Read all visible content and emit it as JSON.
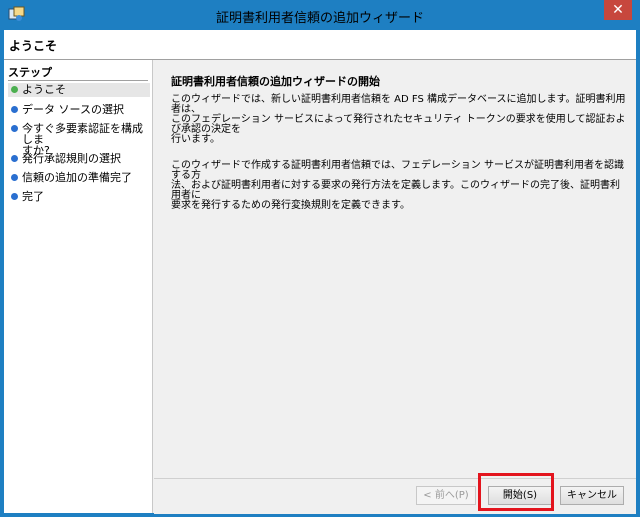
{
  "window": {
    "title": "証明書利用者信頼の追加ウィザード",
    "close_glyph": "✕"
  },
  "header": {
    "title": "ようこそ"
  },
  "sidebar": {
    "heading": "ステップ",
    "items": [
      {
        "label": "ようこそ",
        "bullet_color": "#4caf50"
      },
      {
        "label": "データ ソースの選択",
        "bullet_color": "#2a6fd0"
      },
      {
        "label": "今すぐ多要素認証を構成しま\nすか?",
        "bullet_color": "#2a6fd0"
      },
      {
        "label": "発行承認規則の選択",
        "bullet_color": "#2a6fd0"
      },
      {
        "label": "信頼の追加の準備完了",
        "bullet_color": "#2a6fd0"
      },
      {
        "label": "完了",
        "bullet_color": "#2a6fd0"
      }
    ]
  },
  "main": {
    "title": "証明書利用者信頼の追加ウィザードの開始",
    "paragraph1": "このウィザードでは、新しい証明書利用者信頼を AD FS 構成データベースに追加します。証明書利用者は、\nこのフェデレーション サービスによって発行されたセキュリティ トークンの要求を使用して認証および承認の決定を\n行います。",
    "paragraph2": "このウィザードで作成する証明書利用者信頼では、フェデレーション サービスが証明書利用者を認識する方\n法、および証明書利用者に対する要求の発行方法を定義します。このウィザードの完了後、証明書利用者に\n要求を発行するための発行変換規則を定義できます。"
  },
  "footer": {
    "prev_label": "< 前へ(P)",
    "start_label": "開始(S)",
    "cancel_label": "キャンセル"
  },
  "colors": {
    "title_bar": "#1e7fc2",
    "highlight": "#e3141d"
  },
  "icons": {
    "app": "wizard-app-icon",
    "close": "close-icon"
  }
}
